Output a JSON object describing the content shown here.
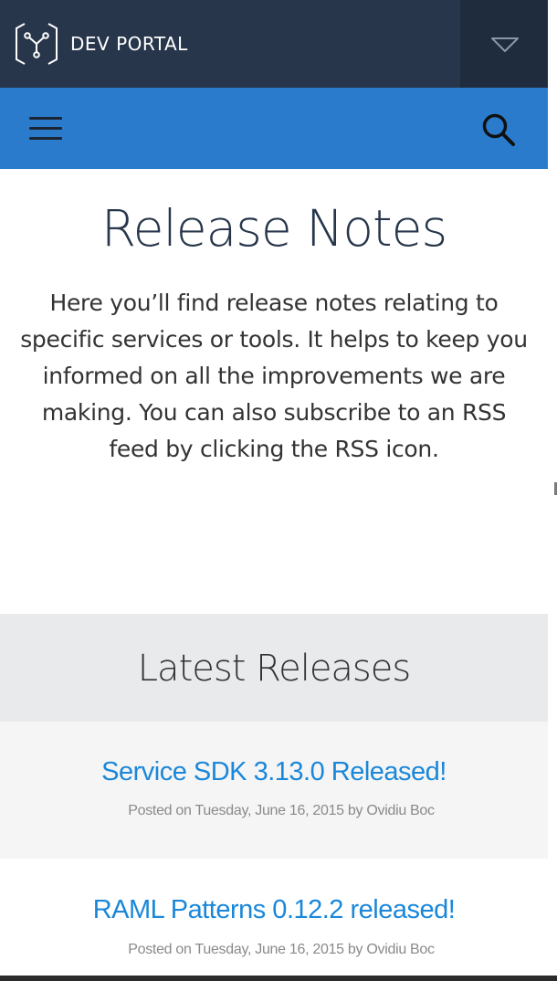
{
  "header": {
    "brand": "DEV PORTAL",
    "logo_icon": "node-graph-hex-logo",
    "menu_icon": "chevron-down-icon",
    "bg_color": "#27364a"
  },
  "navbar": {
    "menu_icon": "hamburger-icon",
    "search_icon": "search-icon",
    "bg_color": "#2b7bcd"
  },
  "hero": {
    "title": "Release Notes",
    "description": "Here you’ll find release notes relating to specific services or tools. It helps to keep you informed on all the improvements we are making. You can also subscribe to an RSS feed by clicking the RSS icon."
  },
  "latest": {
    "heading": "Latest Releases"
  },
  "releases": [
    {
      "title": "Service SDK 3.13.0 Released!",
      "meta": "Posted on Tuesday, June 16, 2015 by Ovidiu Boc"
    },
    {
      "title": "RAML Patterns 0.12.2 released!",
      "meta": "Posted on Tuesday, June 16, 2015 by Ovidiu Boc"
    }
  ],
  "colors": {
    "link": "#1a87d9",
    "title_dark": "#27364a"
  }
}
